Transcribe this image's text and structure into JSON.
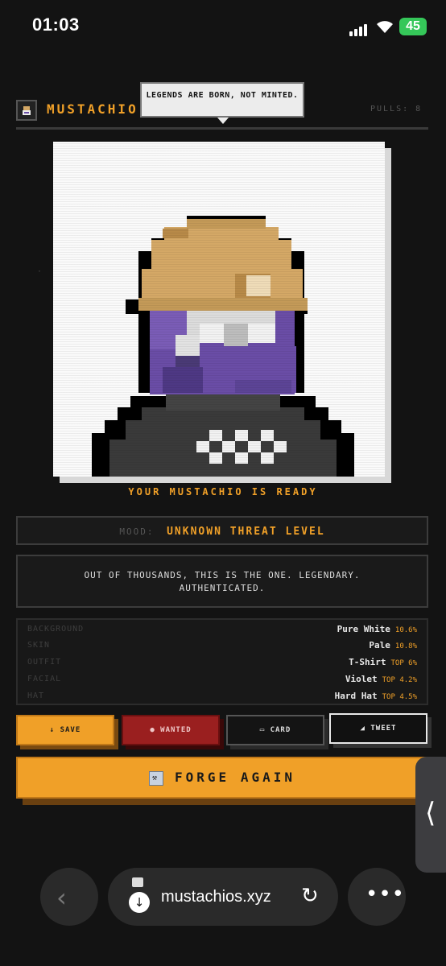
{
  "status_bar": {
    "time": "01:03",
    "battery": "45"
  },
  "header": {
    "brand": "MUSTACHIO",
    "pulls": "PULLS: 8",
    "tooltip": "LEGENDS ARE BORN, NOT MINTED."
  },
  "portrait": {
    "caption": "YOUR MUSTACHIO IS READY",
    "colors": {
      "background": "#fafafa",
      "hat": "#d4a866",
      "face": "#6a4da6",
      "outfit": "#3a3a3a"
    }
  },
  "mood": {
    "label": "MOOD:",
    "value": "UNKNOWN THREAT LEVEL"
  },
  "description": "OUT OF THOUSANDS, THIS IS THE ONE. LEGENDARY. AUTHENTICATED.",
  "traits": [
    {
      "name": "BACKGROUND",
      "value": "Pure White",
      "rarity": "10.6%"
    },
    {
      "name": "SKIN",
      "value": "Pale",
      "rarity": "10.8%"
    },
    {
      "name": "OUTFIT",
      "value": "T-Shirt",
      "rarity": "TOP 6%"
    },
    {
      "name": "FACIAL",
      "value": "Violet",
      "rarity": "TOP 4.2%"
    },
    {
      "name": "HAT",
      "value": "Hard Hat",
      "rarity": "TOP 4.5%"
    }
  ],
  "actions": {
    "save": "↓ SAVE",
    "wanted": "● WANTED",
    "card": "▭ CARD",
    "tweet": "◢ TWEET",
    "forge": "FORGE AGAIN"
  },
  "browser": {
    "url": "mustachios.xyz"
  },
  "theme": {
    "accent": "#f0a028",
    "danger": "#9a1f1f",
    "bg": "#131313"
  }
}
